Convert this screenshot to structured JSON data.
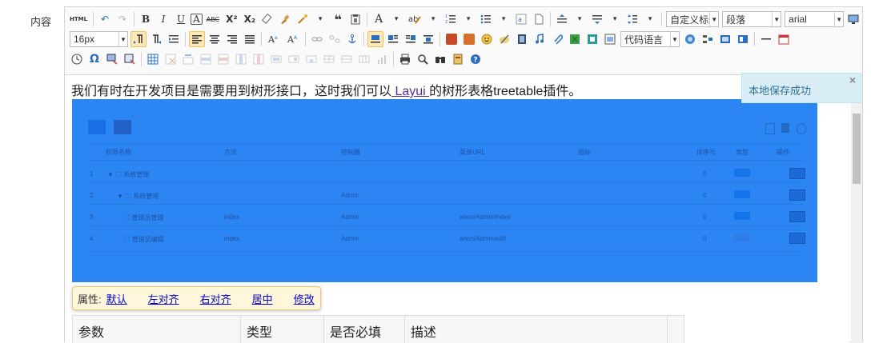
{
  "form": {
    "label": "内容"
  },
  "toolbar": {
    "row1": {
      "html": "HTML",
      "bold": "B",
      "italic": "I",
      "underline": "U",
      "font_border": "A",
      "strike": "ABC",
      "superscript": "X²",
      "subscript": "X₂",
      "quote": "❝",
      "font_color": "A",
      "custom_title_select": "自定义标题",
      "paragraph_select": "段落",
      "font_select": "arial"
    },
    "row2": {
      "font_size_select": "16px",
      "code_lang_select": "代码语言"
    }
  },
  "content": {
    "text_before": "我们有时在开发项目是需要用到树形接口，这时我们可以",
    "link": " Layui ",
    "text_after": "的树形表格treetable插件。"
  },
  "embedded_image": {
    "headers": [
      "权限名称",
      "方法",
      "控制器",
      "菜单URL",
      "图标",
      "排序号",
      "类型",
      "操作"
    ],
    "rows": [
      {
        "id": "1",
        "name": "▼ 🗀 系统管理",
        "method": "",
        "controller": "",
        "url": "",
        "order": "0"
      },
      {
        "id": "2",
        "name": "▼ 🗀 系统管理",
        "method": "",
        "controller": "Admin",
        "url": "",
        "order": "0"
      },
      {
        "id": "3",
        "name": "🗋 管理员管理",
        "method": "index",
        "controller": "Admin",
        "url": "anon/Admin/index",
        "order": "0"
      },
      {
        "id": "4",
        "name": "🗋 管理员编辑",
        "method": "index",
        "controller": "Admin",
        "url": "anon/Admin/edit",
        "order": "0"
      }
    ]
  },
  "image_popup": {
    "label": "属性:",
    "links": [
      "默认",
      "左对齐",
      "右对齐",
      "居中",
      "修改"
    ]
  },
  "table": {
    "headers": [
      "参数",
      "类型",
      "是否必填",
      "描述"
    ]
  },
  "toast": {
    "message": "本地保存成功",
    "close": "×"
  },
  "colors": {
    "accent": "#2b85f3",
    "toast_bg": "#d9edf7",
    "popup_bg": "#fff7dc",
    "active_button": "#fde9b8"
  }
}
